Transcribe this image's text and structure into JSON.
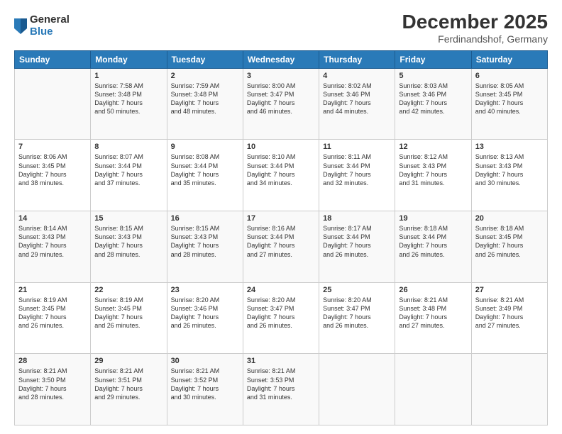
{
  "logo": {
    "general": "General",
    "blue": "Blue"
  },
  "header": {
    "title": "December 2025",
    "location": "Ferdinandshof, Germany"
  },
  "weekdays": [
    "Sunday",
    "Monday",
    "Tuesday",
    "Wednesday",
    "Thursday",
    "Friday",
    "Saturday"
  ],
  "weeks": [
    [
      {
        "day": "",
        "info": ""
      },
      {
        "day": "1",
        "info": "Sunrise: 7:58 AM\nSunset: 3:48 PM\nDaylight: 7 hours\nand 50 minutes."
      },
      {
        "day": "2",
        "info": "Sunrise: 7:59 AM\nSunset: 3:48 PM\nDaylight: 7 hours\nand 48 minutes."
      },
      {
        "day": "3",
        "info": "Sunrise: 8:00 AM\nSunset: 3:47 PM\nDaylight: 7 hours\nand 46 minutes."
      },
      {
        "day": "4",
        "info": "Sunrise: 8:02 AM\nSunset: 3:46 PM\nDaylight: 7 hours\nand 44 minutes."
      },
      {
        "day": "5",
        "info": "Sunrise: 8:03 AM\nSunset: 3:46 PM\nDaylight: 7 hours\nand 42 minutes."
      },
      {
        "day": "6",
        "info": "Sunrise: 8:05 AM\nSunset: 3:45 PM\nDaylight: 7 hours\nand 40 minutes."
      }
    ],
    [
      {
        "day": "7",
        "info": "Sunrise: 8:06 AM\nSunset: 3:45 PM\nDaylight: 7 hours\nand 38 minutes."
      },
      {
        "day": "8",
        "info": "Sunrise: 8:07 AM\nSunset: 3:44 PM\nDaylight: 7 hours\nand 37 minutes."
      },
      {
        "day": "9",
        "info": "Sunrise: 8:08 AM\nSunset: 3:44 PM\nDaylight: 7 hours\nand 35 minutes."
      },
      {
        "day": "10",
        "info": "Sunrise: 8:10 AM\nSunset: 3:44 PM\nDaylight: 7 hours\nand 34 minutes."
      },
      {
        "day": "11",
        "info": "Sunrise: 8:11 AM\nSunset: 3:44 PM\nDaylight: 7 hours\nand 32 minutes."
      },
      {
        "day": "12",
        "info": "Sunrise: 8:12 AM\nSunset: 3:43 PM\nDaylight: 7 hours\nand 31 minutes."
      },
      {
        "day": "13",
        "info": "Sunrise: 8:13 AM\nSunset: 3:43 PM\nDaylight: 7 hours\nand 30 minutes."
      }
    ],
    [
      {
        "day": "14",
        "info": "Sunrise: 8:14 AM\nSunset: 3:43 PM\nDaylight: 7 hours\nand 29 minutes."
      },
      {
        "day": "15",
        "info": "Sunrise: 8:15 AM\nSunset: 3:43 PM\nDaylight: 7 hours\nand 28 minutes."
      },
      {
        "day": "16",
        "info": "Sunrise: 8:15 AM\nSunset: 3:43 PM\nDaylight: 7 hours\nand 28 minutes."
      },
      {
        "day": "17",
        "info": "Sunrise: 8:16 AM\nSunset: 3:44 PM\nDaylight: 7 hours\nand 27 minutes."
      },
      {
        "day": "18",
        "info": "Sunrise: 8:17 AM\nSunset: 3:44 PM\nDaylight: 7 hours\nand 26 minutes."
      },
      {
        "day": "19",
        "info": "Sunrise: 8:18 AM\nSunset: 3:44 PM\nDaylight: 7 hours\nand 26 minutes."
      },
      {
        "day": "20",
        "info": "Sunrise: 8:18 AM\nSunset: 3:45 PM\nDaylight: 7 hours\nand 26 minutes."
      }
    ],
    [
      {
        "day": "21",
        "info": "Sunrise: 8:19 AM\nSunset: 3:45 PM\nDaylight: 7 hours\nand 26 minutes."
      },
      {
        "day": "22",
        "info": "Sunrise: 8:19 AM\nSunset: 3:45 PM\nDaylight: 7 hours\nand 26 minutes."
      },
      {
        "day": "23",
        "info": "Sunrise: 8:20 AM\nSunset: 3:46 PM\nDaylight: 7 hours\nand 26 minutes."
      },
      {
        "day": "24",
        "info": "Sunrise: 8:20 AM\nSunset: 3:47 PM\nDaylight: 7 hours\nand 26 minutes."
      },
      {
        "day": "25",
        "info": "Sunrise: 8:20 AM\nSunset: 3:47 PM\nDaylight: 7 hours\nand 26 minutes."
      },
      {
        "day": "26",
        "info": "Sunrise: 8:21 AM\nSunset: 3:48 PM\nDaylight: 7 hours\nand 27 minutes."
      },
      {
        "day": "27",
        "info": "Sunrise: 8:21 AM\nSunset: 3:49 PM\nDaylight: 7 hours\nand 27 minutes."
      }
    ],
    [
      {
        "day": "28",
        "info": "Sunrise: 8:21 AM\nSunset: 3:50 PM\nDaylight: 7 hours\nand 28 minutes."
      },
      {
        "day": "29",
        "info": "Sunrise: 8:21 AM\nSunset: 3:51 PM\nDaylight: 7 hours\nand 29 minutes."
      },
      {
        "day": "30",
        "info": "Sunrise: 8:21 AM\nSunset: 3:52 PM\nDaylight: 7 hours\nand 30 minutes."
      },
      {
        "day": "31",
        "info": "Sunrise: 8:21 AM\nSunset: 3:53 PM\nDaylight: 7 hours\nand 31 minutes."
      },
      {
        "day": "",
        "info": ""
      },
      {
        "day": "",
        "info": ""
      },
      {
        "day": "",
        "info": ""
      }
    ]
  ]
}
